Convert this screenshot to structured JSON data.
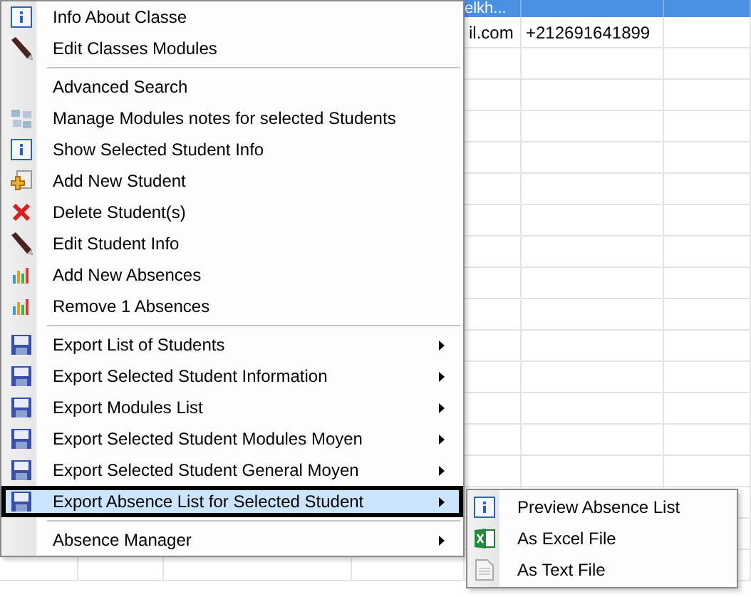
{
  "grid": {
    "header": {
      "column_5": "elkh..."
    },
    "rows": [
      {
        "column_5": "il.com",
        "column_6": "+212691641899"
      }
    ]
  },
  "context_menu": {
    "items": [
      {
        "kind": "item",
        "label": "Info About Classe",
        "selected": false,
        "submenu": false
      },
      {
        "kind": "item",
        "label": "Edit Classes Modules",
        "selected": false,
        "submenu": false
      },
      {
        "kind": "separator"
      },
      {
        "kind": "item",
        "label": "Advanced Search",
        "selected": false,
        "submenu": false
      },
      {
        "kind": "item",
        "label": "Manage Modules notes for selected Students",
        "selected": false,
        "submenu": false
      },
      {
        "kind": "item",
        "label": "Show Selected Student Info",
        "selected": false,
        "submenu": false
      },
      {
        "kind": "item",
        "label": "Add New Student",
        "selected": false,
        "submenu": false
      },
      {
        "kind": "item",
        "label": "Delete Student(s)",
        "selected": false,
        "submenu": false
      },
      {
        "kind": "item",
        "label": "Edit Student Info",
        "selected": false,
        "submenu": false
      },
      {
        "kind": "item",
        "label": "Add New Absences",
        "selected": false,
        "submenu": false
      },
      {
        "kind": "item",
        "label": "Remove 1 Absences",
        "selected": false,
        "submenu": false
      },
      {
        "kind": "separator"
      },
      {
        "kind": "item",
        "label": "Export List of Students",
        "selected": false,
        "submenu": true
      },
      {
        "kind": "item",
        "label": "Export Selected Student Information",
        "selected": false,
        "submenu": true
      },
      {
        "kind": "item",
        "label": "Export Modules List",
        "selected": false,
        "submenu": true
      },
      {
        "kind": "item",
        "label": "Export Selected Student Modules Moyen",
        "selected": false,
        "submenu": true
      },
      {
        "kind": "item",
        "label": "Export Selected Student General Moyen",
        "selected": false,
        "submenu": true
      },
      {
        "kind": "item",
        "label": "Export Absence List for Selected Student",
        "selected": true,
        "submenu": true
      },
      {
        "kind": "separator"
      },
      {
        "kind": "item",
        "label": "Absence Manager",
        "selected": false,
        "submenu": true
      }
    ]
  },
  "submenu": {
    "items": [
      {
        "label": "Preview Absence List",
        "selected": false
      },
      {
        "label": "As Excel File",
        "selected": false
      },
      {
        "label": "As Text File",
        "selected": false
      }
    ]
  }
}
